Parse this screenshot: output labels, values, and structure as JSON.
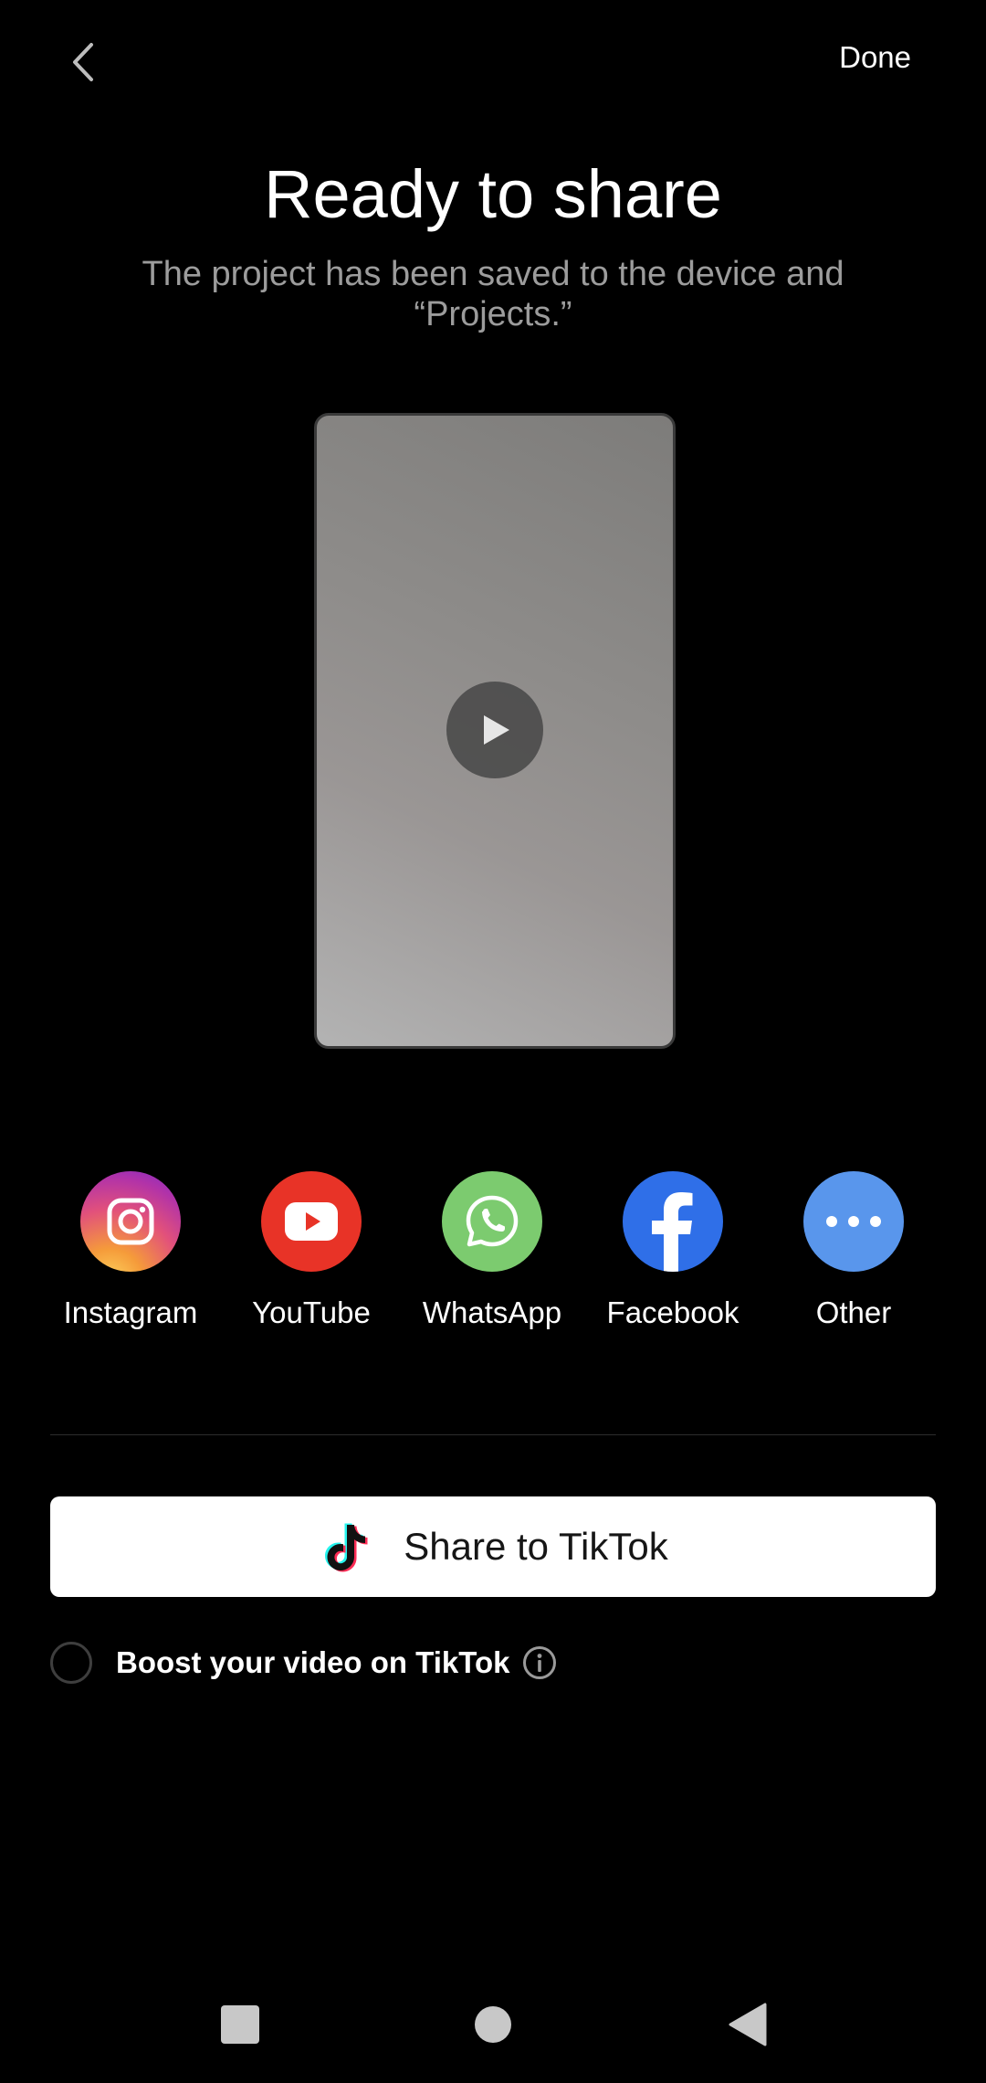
{
  "header": {
    "back_icon": "chevron-left-icon",
    "done_label": "Done"
  },
  "main": {
    "title": "Ready to share",
    "subtitle": "The project has been saved to the device and “Projects.”",
    "preview_play_icon": "play-icon"
  },
  "share": {
    "targets": [
      {
        "label": "Instagram",
        "icon": "instagram-icon",
        "color": "#d6287a"
      },
      {
        "label": "YouTube",
        "icon": "youtube-icon",
        "color": "#e83327"
      },
      {
        "label": "WhatsApp",
        "icon": "whatsapp-icon",
        "color": "#7ccb6f"
      },
      {
        "label": "Facebook",
        "icon": "facebook-icon",
        "color": "#2f6fe8"
      },
      {
        "label": "Other",
        "icon": "more-icon",
        "color": "#5996ec"
      }
    ]
  },
  "tiktok": {
    "button_label": "Share to TikTok",
    "boost_label": "Boost your video on TikTok",
    "boost_checked": false,
    "info_icon": "info-icon"
  },
  "navbar": {
    "recents_icon": "square-icon",
    "home_icon": "circle-icon",
    "back_icon": "triangle-back-icon"
  }
}
